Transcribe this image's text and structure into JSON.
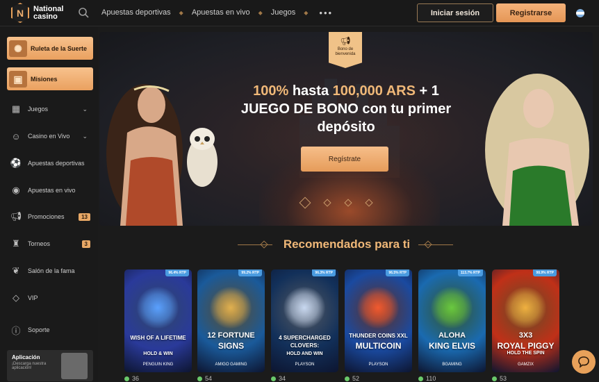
{
  "brand": {
    "line1": "National",
    "line2": "casino",
    "badge": "N"
  },
  "nav": {
    "items": [
      "Apuestas deportivas",
      "Apuestas en vivo",
      "Juegos"
    ],
    "more": "•••"
  },
  "auth": {
    "login": "Iniciar sesión",
    "register": "Registrarse"
  },
  "sidebar": {
    "promo": [
      {
        "label": "Ruleta de la Suerte",
        "icon": "wheel-icon"
      },
      {
        "label": "Misiones",
        "icon": "chest-icon"
      }
    ],
    "items": [
      {
        "label": "Juegos",
        "icon": "games-icon",
        "chevron": true
      },
      {
        "label": "Casino en Vivo",
        "icon": "live-casino-icon",
        "chevron": true
      },
      {
        "label": "Apuestas deportivas",
        "icon": "soccer-ball-icon"
      },
      {
        "label": "Apuestas en vivo",
        "icon": "live-signal-icon"
      },
      {
        "label": "Promociones",
        "icon": "megaphone-icon",
        "count": "13"
      },
      {
        "label": "Torneos",
        "icon": "tournament-icon",
        "count": "3"
      },
      {
        "label": "Salón de la fama",
        "icon": "laurel-icon"
      },
      {
        "label": "VIP",
        "icon": "diamond-icon"
      },
      {
        "label": "Soporte",
        "icon": "help-icon"
      }
    ],
    "app": {
      "title": "Aplicación",
      "subtitle": "¡Descarga nuestra aplicación!"
    }
  },
  "hero": {
    "tag": "Bono de bienvenida",
    "title_p1": "100%",
    "title_p2": " hasta ",
    "title_p3": "100,000 ARS",
    "title_p4": " + 1",
    "title_p5": "JUEGO DE BONO con tu primer depósito",
    "cta": "Regístrate",
    "slides": 4,
    "active_slide": 0
  },
  "recommended": {
    "title": "Recomendados para ti",
    "games": [
      {
        "title": "WISH OF A LIFETIME",
        "tag": "HOLD & WIN",
        "provider": "PENGUIN KING",
        "rtp": "96.4% RTP",
        "players": "36",
        "bg": "#2a3a9a",
        "accent": "#5aa0ff"
      },
      {
        "title": "12 FORTUNE",
        "title2": "SIGNS",
        "provider": "AMIGO GAMING",
        "rtp": "99.2% RTP",
        "players": "54",
        "bg": "#1a5a9a",
        "accent": "#e0b050"
      },
      {
        "title": "4 SUPERCHARGED CLOVERS:",
        "tag": "HOLD AND WIN",
        "provider": "PLAYSON",
        "rtp": "96.3% RTP",
        "players": "34",
        "bg": "#12305a",
        "accent": "#c8d8f0"
      },
      {
        "title": "THUNDER COINS XXL",
        "title2": "MULTICOIN",
        "provider": "PLAYSON",
        "rtp": "96.5% RTP",
        "players": "52",
        "bg": "#1a4aa0",
        "accent": "#f05a30"
      },
      {
        "title": "ALOHA",
        "title2": "KING ELVIS",
        "provider": "BGAMING",
        "rtp": "113.7% RTP",
        "players": "110",
        "bg": "#1a6ab0",
        "accent": "#6ac940"
      },
      {
        "title": "3X3",
        "title2": "ROYAL PIGGY",
        "tag": "HOLD THE SPIN",
        "provider": "GAMZIX",
        "rtp": "98.9% RTP",
        "players": "53",
        "bg": "#c03018",
        "accent": "#f0b040"
      }
    ]
  }
}
